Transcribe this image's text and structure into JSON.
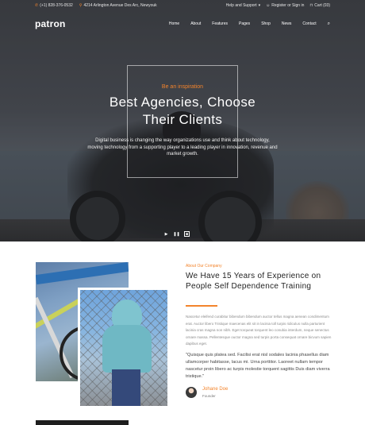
{
  "topbar": {
    "phone": "(+1) 828-376-0532",
    "address": "4214 Arlington Avenue Des Arc, Newyouk",
    "help": "Help and Support",
    "account": "Register or Sign in",
    "cart": "Cart (03)"
  },
  "nav": {
    "logo": "patron",
    "items": [
      "Home",
      "About",
      "Features",
      "Pages",
      "Shop",
      "News",
      "Contact"
    ]
  },
  "hero": {
    "kicker": "Be an inspiration",
    "title_line1": "Best Agencies, Choose",
    "title_line2": "Their Clients",
    "description": "Digital business is changing the way organizations use and think about technology, moving technology from a supporting player to a leading player in innovation, revenue and market growth."
  },
  "about": {
    "kicker": "About Our Company",
    "title": "We Have 15 Years of Experience on People Self Dependence Training",
    "paragraph": "Nascetur eleifend curabitur bibendum bibendum auctor tellus magna aenean condimentum erat. Auctor libero Tristique maecenas elit sit in lacinia toll turpis ridiculus nulla parturient lacinia cras magna non nibh. Eget torqueat torquent leo conubia interdum, neque senectus ornare massa. Pellentesque ouctor magna sed turpis porta consequat ornare bicvum sapien dapibus eget.",
    "quote": "\"Quisque quis platea sed. Facilisi erat nisl sodales lacinia phasellus diam ullamcorper habitasse, lacus mi. Urna porttitor. Laoreet nullam tempor nascetur proin libero ac turpis molestie torquent sagittis Duis diam viverra tristique.\"",
    "author_name": "Johane Doe",
    "author_role": "Founder"
  },
  "colors": {
    "accent": "#f3842c",
    "heading": "#222222",
    "body_text": "#8a8a8a"
  },
  "icons": {
    "phone": "phone-icon",
    "address": "map-pin-icon",
    "help_chevron": "chevron-down-icon",
    "account": "user-icon",
    "cart": "bag-icon",
    "search": "search-icon"
  }
}
